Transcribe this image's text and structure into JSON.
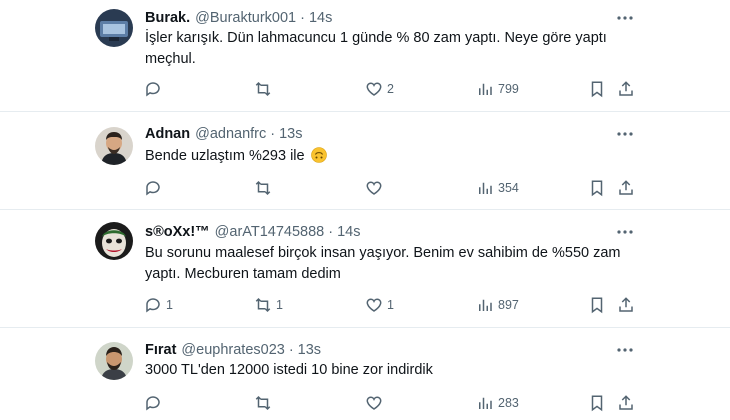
{
  "tweets": [
    {
      "name": "Burak.",
      "handle": "@Burakturk001",
      "time": "14s",
      "text": "İşler karışık. Dün lahmacuncu 1 günde % 80 zam yaptı. Neye göre yaptı meçhul.",
      "replies": "",
      "retweets": "",
      "likes": "2",
      "views": "799"
    },
    {
      "name": "Adnan",
      "handle": "@adnanfrc",
      "time": "13s",
      "text": "Bende uzlaştım %293 ile",
      "replies": "",
      "retweets": "",
      "likes": "",
      "views": "354"
    },
    {
      "name": "s®oXx!™",
      "handle": "@arAT14745888",
      "time": "14s",
      "text": "Bu sorunu maalesef birçok insan yaşıyor. Benim ev sahibim de %550 zam yaptı. Mecburen tamam dedim",
      "replies": "1",
      "retweets": "1",
      "likes": "1",
      "views": "897"
    },
    {
      "name": "Fırat",
      "handle": "@euphrates023",
      "time": "13s",
      "text": "3000 TL'den 12000 istedi 10 bine zor indirdik",
      "replies": "",
      "retweets": "",
      "likes": "",
      "views": "283"
    }
  ],
  "separator": "·",
  "icons": {
    "more": "more-horizontal-icon",
    "reply": "reply-icon",
    "retweet": "retweet-icon",
    "like": "heart-icon",
    "views": "views-chart-icon",
    "bookmark": "bookmark-icon",
    "share": "share-icon",
    "emoji": "upside-down-face-emoji"
  },
  "colors": {
    "text": "#0f1419",
    "secondary": "#536471",
    "border": "#e6ecf0",
    "emoji": "#f9c22e"
  }
}
